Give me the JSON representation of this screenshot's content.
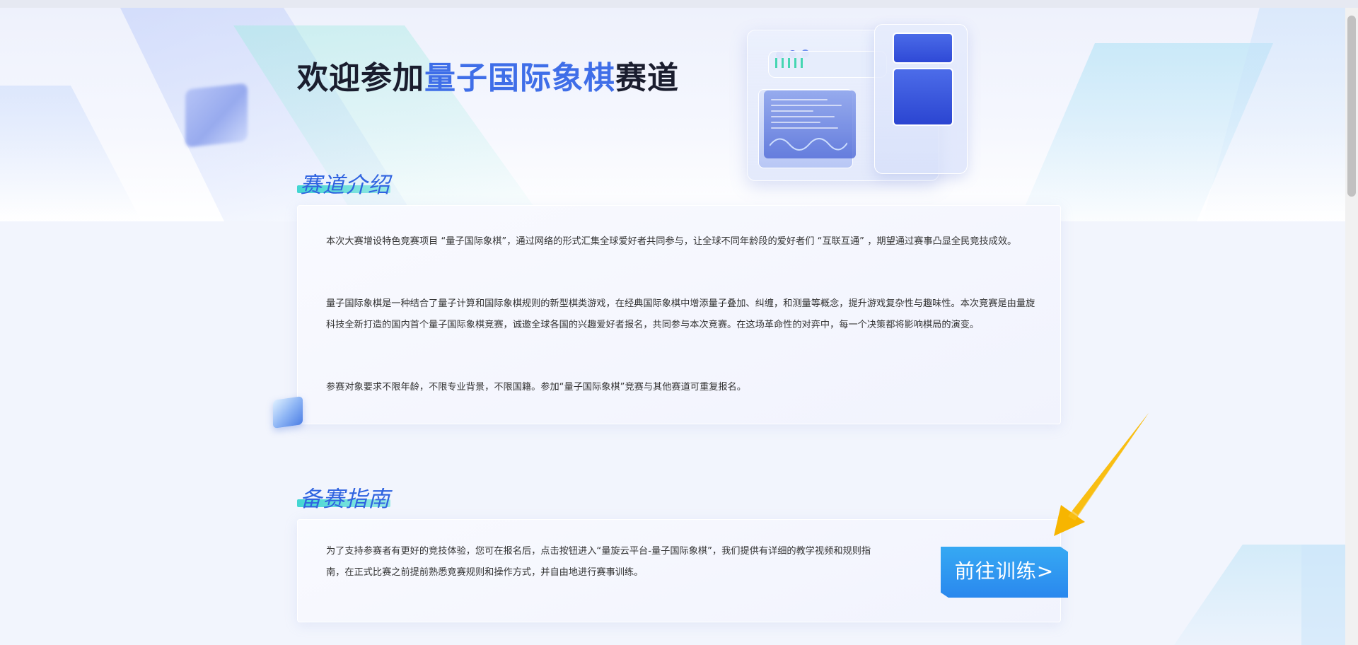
{
  "hero": {
    "title_prefix": "欢迎参加",
    "title_highlight": "量子国际象棋",
    "title_suffix": "赛道"
  },
  "intro": {
    "title": "赛道介绍",
    "paragraphs": [
      "本次大赛增设特色竞赛项目 “量子国际象棋”，通过网络的形式汇集全球爱好者共同参与，让全球不同年龄段的爱好者们 “互联互通” ，期望通过赛事凸显全民竞技成效。",
      "量子国际象棋是一种结合了量子计算和国际象棋规则的新型棋类游戏，在经典国际象棋中增添量子叠加、纠缠，和测量等概念，提升游戏复杂性与趣味性。本次竞赛是由量旋科技全新打造的国内首个量子国际象棋竞赛，诚邀全球各国的兴趣爱好者报名，共同参与本次竞赛。在这场革命性的对弈中，每一个决策都将影响棋局的演变。",
      "参赛对象要求不限年龄，不限专业背景，不限国籍。参加“量子国际象棋”竞赛与其他赛道可重复报名。"
    ]
  },
  "guide": {
    "title": "备赛指南",
    "paragraph": "为了支持参赛者有更好的竞技体验，您可在报名后，点击按钮进入“量旋云平台-量子国际象棋”，我们提供有详细的教学视频和规则指南，在正式比赛之前提前熟悉竞赛规则和操作方式，并自由地进行赛事训练。",
    "button_label": "前往训练>"
  },
  "colors": {
    "accent_blue": "#3f6ee8",
    "button_blue": "#2a88ee",
    "underline_teal": "#42d6d2",
    "arrow_orange": "#f7b500"
  },
  "icons": [
    "cube-icon",
    "arrow-annotation-icon"
  ]
}
